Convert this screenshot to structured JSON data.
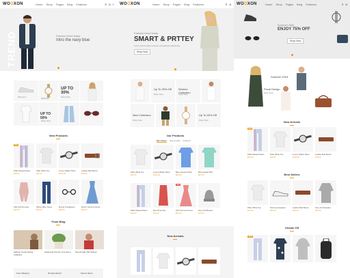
{
  "panels": [
    {
      "logo_pre": "WO",
      "logo_mid": "O",
      "logo_post": "XON",
      "nav": [
        "Home",
        "Shop",
        "Pages",
        "Blog",
        "Features"
      ],
      "hero": {
        "vertical": "TREND",
        "subtitle": "Fashion trend today",
        "title": "Intro the navy blue"
      },
      "promos": {
        "women": "Women's",
        "watches": "Watches",
        "up_to": "UP TO 30%",
        "up_to_2": "UP TO 50%",
        "shop_now": "Shop Now"
      },
      "new_products": {
        "title": "New Products",
        "items": [
          {
            "name": "Plaid Pleated Pants",
            "price": "$18.00",
            "stars": "★★★★★"
          },
          {
            "name": "Plain White Tee",
            "price": "$16.00",
            "stars": "★★★★★"
          },
          {
            "name": "Luxury Watch Silver",
            "price": "$120.00",
            "stars": "★★★★★"
          },
          {
            "name": "Leather Belt Brown",
            "price": "$15.00",
            "stars": "★★★★★"
          },
          {
            "name": "Kids Pink Romper",
            "price": "$20.00",
            "stars": "★★★★★"
          },
          {
            "name": "Skinny Blue Jeans",
            "price": "$35.00",
            "stars": "★★★★★"
          },
          {
            "name": "Round Sunglasses",
            "price": "$25.00",
            "stars": "★★★★★"
          },
          {
            "name": "Denim Summer Dress",
            "price": "$45.00",
            "stars": "★★★★★"
          }
        ]
      },
      "blog": {
        "title": "From Blog",
        "posts": [
          {
            "title": "Fashion Trends Spring Collection"
          },
          {
            "title": "Gardening Tips For Your Home"
          },
          {
            "title": "New Arrivals This Season"
          }
        ]
      },
      "features": [
        "Free Shipping",
        "30 days Return",
        "Secure Store"
      ]
    },
    {
      "nav": [
        "Home",
        "Shop",
        "Pages",
        "Blog",
        "Features"
      ],
      "hero": {
        "subtitle": "Fashion trend today",
        "title": "SMART & PRTTEY",
        "desc": "Lorem ipsum dolor sit amet consectetur adipiscing",
        "button": "Shop Now"
      },
      "promos": {
        "up_to": "Up To 30% Off",
        "women": "Women Collection",
        "new_coll": "New Collection",
        "up_to_2": "Up To 50% Off",
        "shop_now": "Shop Now"
      },
      "our_products": {
        "title": "Our Products",
        "tabs": [
          "Best Sellers",
          "New Arrivals",
          "Featured"
        ],
        "items": [
          {
            "name": "Plain White Tee",
            "price": "$16.00",
            "stars": "★★★★★"
          },
          {
            "name": "Luxury Watch Silver",
            "price": "$120.00",
            "stars": "★★★★★"
          },
          {
            "name": "Blue Checked Shirt",
            "price": "$29.00",
            "stars": "★★★★★"
          },
          {
            "name": "Mint Casual Shirt",
            "price": "$27.00",
            "stars": "★★★★★"
          },
          {
            "name": "Plaid Pleated Pants",
            "price": "$18.00",
            "stars": "★★★★★"
          },
          {
            "name": "Red Floral Top",
            "price": "$22.00",
            "stars": "★★★★★"
          },
          {
            "name": "Pink Summer Dress",
            "price": "$39.00",
            "stars": "★★★★★"
          },
          {
            "name": "Grey Knit Beanie",
            "price": "$12.00",
            "stars": "★★★★★"
          }
        ]
      },
      "new_arrivals": {
        "title": "New Arrivals"
      }
    },
    {
      "nav": [
        "Home",
        "Shop",
        "Pages",
        "Blog",
        "Features"
      ],
      "hero": {
        "subtitle": "Summer Sale",
        "title": "ENJOY 75% OFF",
        "button": "Shop Now"
      },
      "promos": {
        "summer": "Summer 2018",
        "floral": "Floral Design",
        "shop_now": "Shop Now"
      },
      "new_arrivals": {
        "title": "New Arrivals",
        "items": [
          {
            "name": "Plaid Pleated Pants",
            "price": "$18.00",
            "stars": "★★★★★"
          },
          {
            "name": "Plain White Tee",
            "price": "$16.00",
            "stars": "★★★★★"
          },
          {
            "name": "Luxury Watch Silver",
            "price": "$120.00",
            "stars": "★★★★★"
          },
          {
            "name": "Leather Belt Brown",
            "price": "$15.00",
            "stars": "★★★★★"
          }
        ]
      },
      "best_sellers": {
        "title": "Best Sellers",
        "items": [
          {
            "name": "Plain White Tee",
            "price": "$16.00",
            "stars": "★★★★★"
          },
          {
            "name": "Running Sneakers",
            "price": "$55.00",
            "stars": "★★★★★"
          },
          {
            "name": "Leather Belt Brown",
            "price": "$15.00",
            "stars": "★★★★★"
          },
          {
            "name": "Grey Knit Sweater",
            "price": "$42.00",
            "stars": "★★★★★"
          }
        ]
      },
      "onsale": {
        "title": "Onsale Off"
      }
    }
  ],
  "colors": {
    "accent": "#f39c12",
    "sale": "#e74c3c"
  }
}
